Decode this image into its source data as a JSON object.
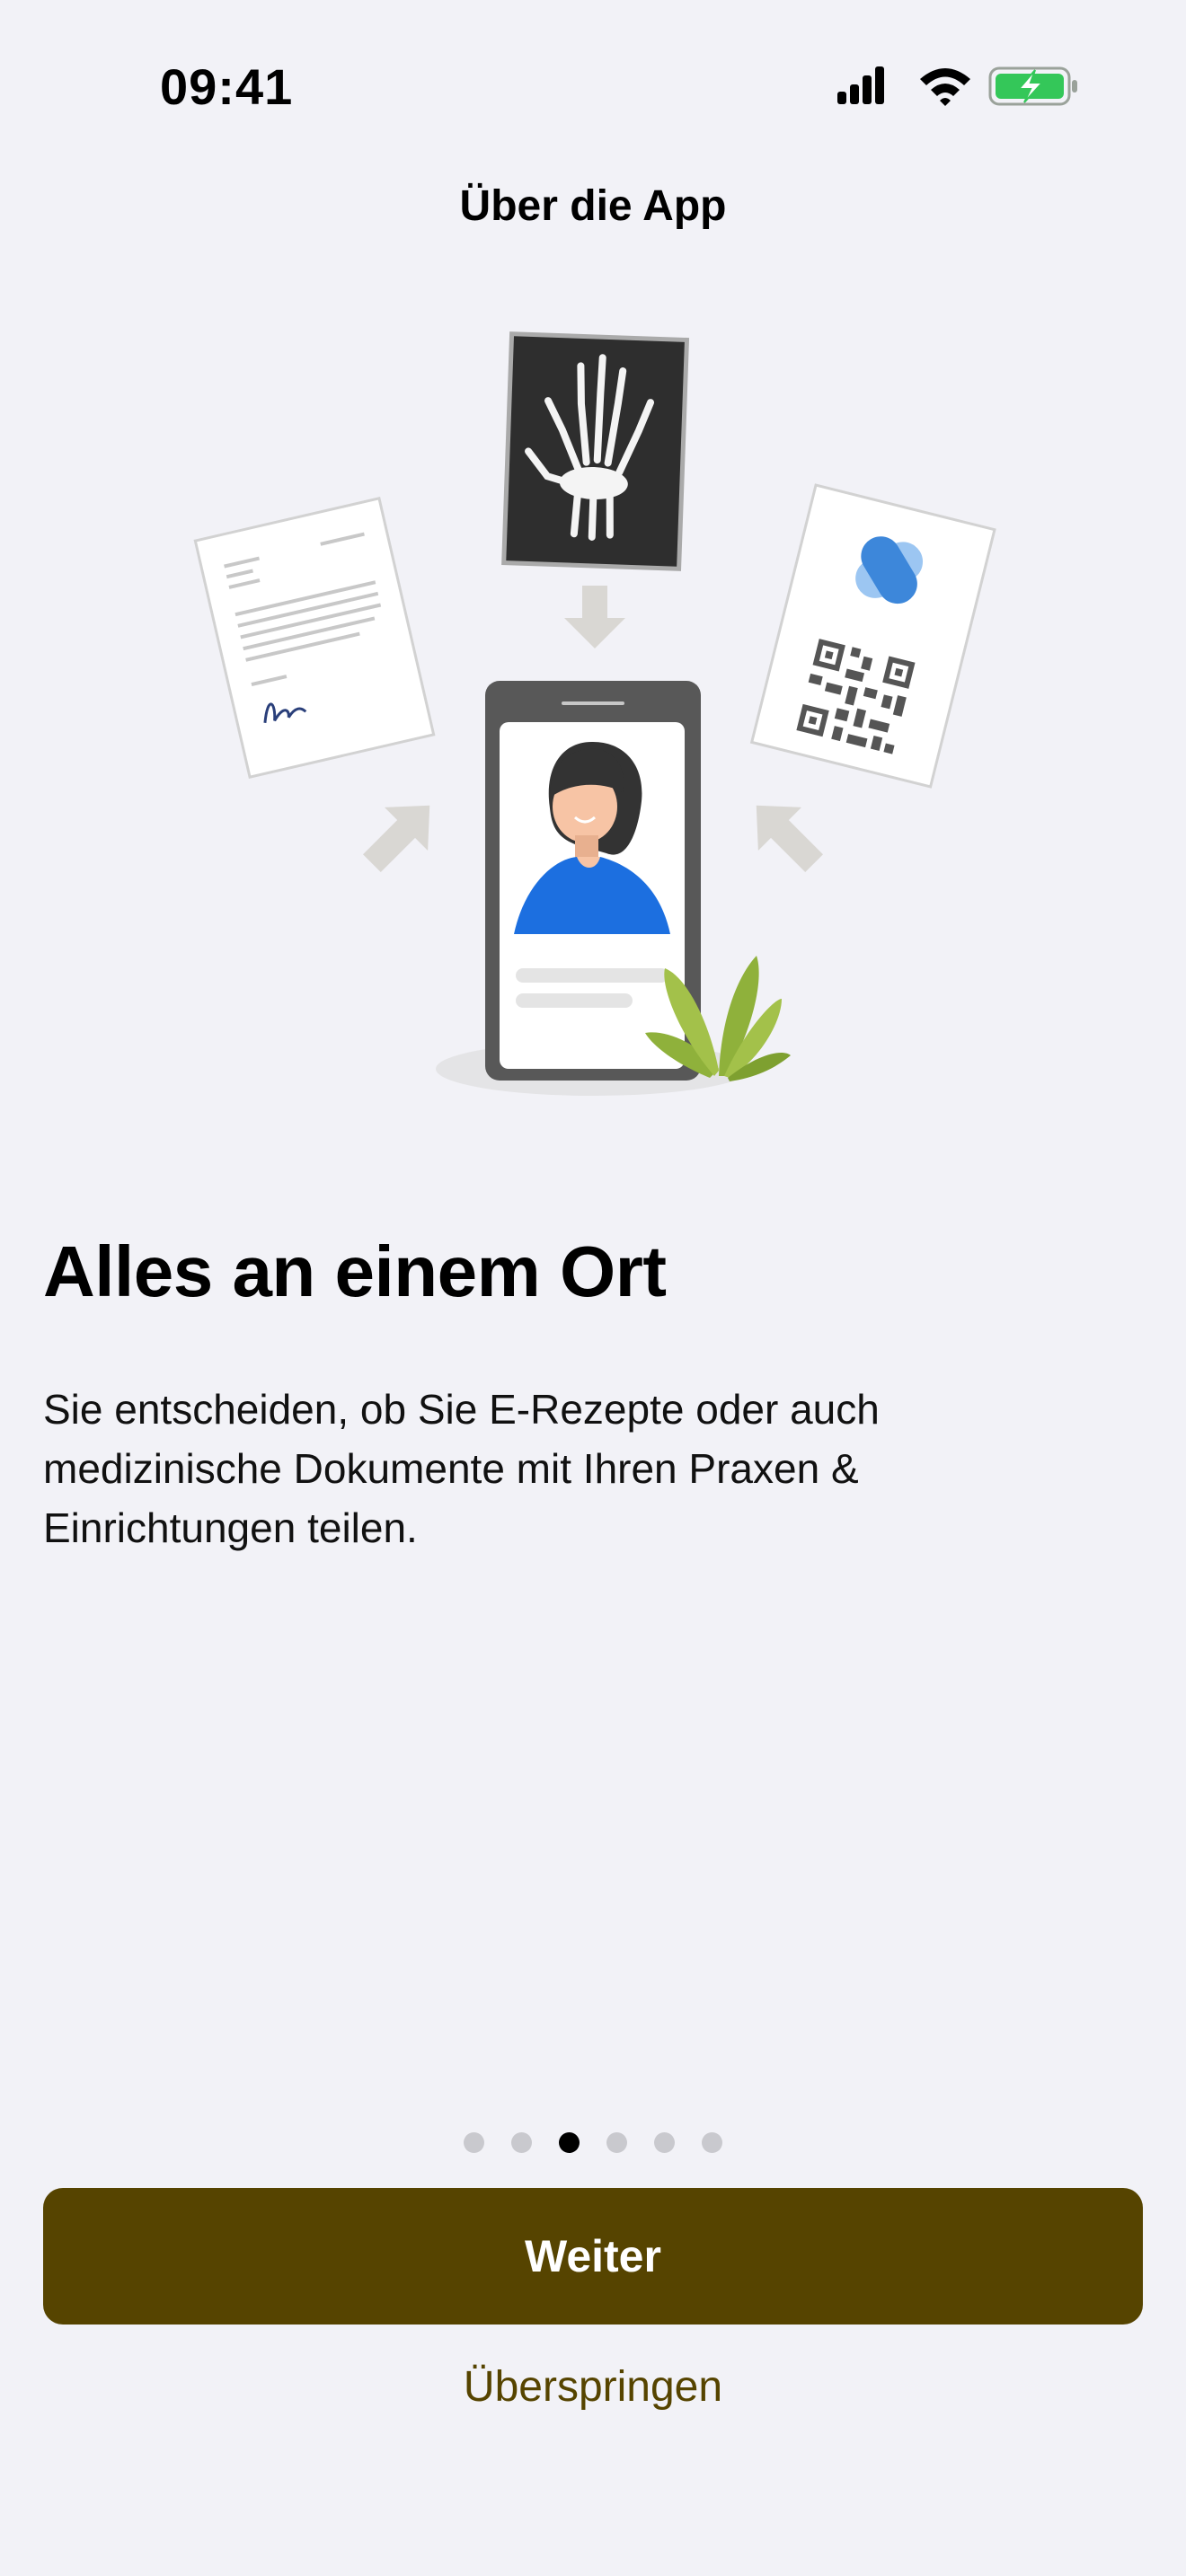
{
  "status_bar": {
    "time": "09:41",
    "icons": [
      "cellular-signal-icon",
      "wifi-icon",
      "battery-charging-icon"
    ],
    "battery_color": "#34C759"
  },
  "nav": {
    "title": "Über die App"
  },
  "onboarding": {
    "headline": "Alles an einem Ort",
    "body": "Sie entscheiden, ob Sie E-Rezepte oder auch medizinische Dokumente mit Ihren Praxen & Einrichtungen teilen.",
    "pages_total": 6,
    "current_page": 3
  },
  "actions": {
    "primary_label": "Weiter",
    "skip_label": "Überspringen"
  },
  "colors": {
    "accent": "#564400",
    "background": "#F2F2F7",
    "person_shirt": "#1C6FE0",
    "plant": "#8FB13B"
  }
}
